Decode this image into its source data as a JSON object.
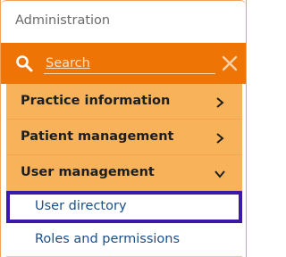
{
  "header": {
    "title": "Administration"
  },
  "search": {
    "placeholder": "Search",
    "value": ""
  },
  "nav": {
    "items": [
      {
        "label": "Practice information",
        "expanded": false
      },
      {
        "label": "Patient management",
        "expanded": false
      },
      {
        "label": "User management",
        "expanded": true
      }
    ],
    "sub_items": [
      {
        "label": "User directory",
        "focused": true
      },
      {
        "label": "Roles and permissions",
        "focused": false
      }
    ]
  },
  "colors": {
    "search_bar": "#ee7406",
    "nav_item_bg": "#f8b35a",
    "focus_outline": "#3b18a8",
    "sub_link_text": "#1a4f8a"
  },
  "icons": {
    "search": "search-icon",
    "clear": "close-icon",
    "collapsed": "chevron-right-icon",
    "expanded": "chevron-down-icon"
  }
}
